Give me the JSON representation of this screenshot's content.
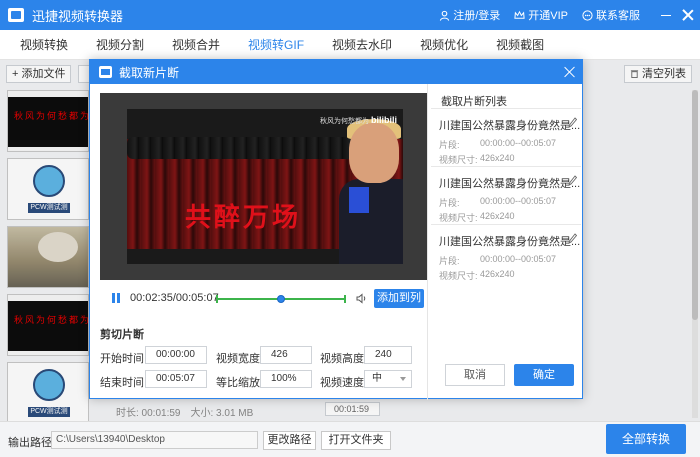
{
  "app": {
    "title": "迅捷视频转换器"
  },
  "topbar": {
    "login": "注册/登录",
    "vip": "开通VIP",
    "service": "联系客服"
  },
  "tabs": [
    {
      "label": "视频转换"
    },
    {
      "label": "视频分割"
    },
    {
      "label": "视频合并"
    },
    {
      "label": "视频转GIF",
      "active": true
    },
    {
      "label": "视频去水印"
    },
    {
      "label": "视频优化"
    },
    {
      "label": "视频截图"
    }
  ],
  "toolbar": {
    "add_file": "添加文件",
    "clear_list": "清空列表"
  },
  "thumbnails": {
    "red_text": "秋风为何愁都为",
    "mascot_label": "PCW测试测试"
  },
  "list_row": {
    "duration_label": "时长: 00:01:59",
    "size_label": "大小: 3.01 MB",
    "stepper_value": "00:01:59"
  },
  "bottom": {
    "output_label": "输出路径:",
    "output_path": "C:\\Users\\13940\\Desktop",
    "change_path": "更改路径",
    "open_folder": "打开文件夹",
    "convert_all": "全部转换"
  },
  "dialog": {
    "title": "截取新片断",
    "video": {
      "caption": "共醉万场",
      "watermark": "秋风为何愁都为",
      "watermark_brand": "bilibili"
    },
    "player": {
      "time": "00:02:35/00:05:07",
      "progress": 0.5,
      "clip_start": 0.0,
      "clip_end": 1.0
    },
    "add_to_list": "添加到列表",
    "clip_section_title": "剪切片断",
    "fields": {
      "start_label": "开始时间:",
      "start_value": "00:00:00",
      "end_label": "结束时间:",
      "end_value": "00:05:07",
      "width_label": "视频宽度:",
      "width_value": "426",
      "scale_label": "等比缩放:",
      "scale_value": "100%",
      "height_label": "视频高度:",
      "height_value": "240",
      "speed_label": "视频速度:",
      "speed_value": "中"
    },
    "clip_list_title": "截取片断列表",
    "clips": [
      {
        "name": "川建国公然暴露身份竟然是...",
        "segment": "片段:",
        "segment_value": "00:00:00--00:05:07",
        "size_label": "视频尺寸:",
        "size_value": "426x240"
      },
      {
        "name": "川建国公然暴露身份竟然是...",
        "segment": "片段:",
        "segment_value": "00:00:00--00:05:07",
        "size_label": "视频尺寸:",
        "size_value": "426x240"
      },
      {
        "name": "川建国公然暴露身份竟然是...",
        "segment": "片段:",
        "segment_value": "00:00:00--00:05:07",
        "size_label": "视频尺寸:",
        "size_value": "426x240"
      }
    ],
    "cancel": "取消",
    "ok": "确定"
  },
  "colors": {
    "accent": "#2c84ea",
    "slider": "#3cb44b",
    "caption_red": "#e0101a"
  }
}
